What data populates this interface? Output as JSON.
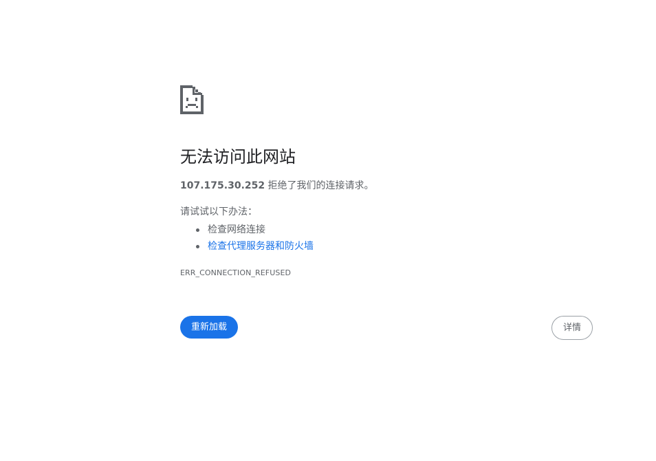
{
  "error_page": {
    "icon": "sad-page-icon",
    "title": "无法访问此网站",
    "host": "107.175.30.252",
    "summary_suffix": " 拒绝了我们的连接请求。",
    "try_label": "请试试以下办法：",
    "suggestions": [
      {
        "label": "检查网络连接",
        "is_link": false
      },
      {
        "label": "检查代理服务器和防火墙",
        "is_link": true
      }
    ],
    "error_code": "ERR_CONNECTION_REFUSED",
    "reload_label": "重新加载",
    "details_label": "详情"
  },
  "colors": {
    "accent": "#1a73e8",
    "text_primary": "#202124",
    "text_secondary": "#5f6368",
    "icon": "#5f6368",
    "background": "#ffffff"
  }
}
